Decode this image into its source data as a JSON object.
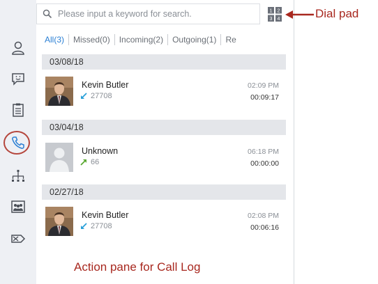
{
  "search": {
    "placeholder": "Please input a keyword for search."
  },
  "dialpad": {
    "icon": "dialpad-icon"
  },
  "tabs": [
    {
      "label": "All(3)",
      "active": true
    },
    {
      "label": "Missed(0)",
      "active": false
    },
    {
      "label": "Incoming(2)",
      "active": false
    },
    {
      "label": "Outgoing(1)",
      "active": false
    },
    {
      "label": "Re",
      "active": false
    }
  ],
  "groups": [
    {
      "date": "03/08/18",
      "entries": [
        {
          "name": "Kevin Butler",
          "number": "27708",
          "direction": "incoming",
          "time": "02:09 PM",
          "duration": "00:09:17",
          "avatar": "photo"
        }
      ]
    },
    {
      "date": "03/04/18",
      "entries": [
        {
          "name": "Unknown",
          "number": "66",
          "direction": "outgoing",
          "time": "06:18 PM",
          "duration": "00:00:00",
          "avatar": "default"
        }
      ]
    },
    {
      "date": "02/27/18",
      "entries": [
        {
          "name": "Kevin Butler",
          "number": "27708",
          "direction": "incoming",
          "time": "02:08 PM",
          "duration": "00:06:16",
          "avatar": "photo"
        }
      ]
    }
  ],
  "sidebar": {
    "items": [
      {
        "icon": "contacts-icon"
      },
      {
        "icon": "chat-icon"
      },
      {
        "icon": "tasks-icon"
      },
      {
        "icon": "call-log-icon",
        "highlighted": true
      },
      {
        "icon": "organization-icon"
      },
      {
        "icon": "group-icon"
      },
      {
        "icon": "voicemail-icon"
      }
    ]
  },
  "annotations": {
    "dial_pad": "Dial pad",
    "action_pane": "Action pane for Call Log"
  },
  "colors": {
    "annotation": "#a8281f",
    "active_tab": "#2a7fd4",
    "incoming_arrow": "#2aa0d8",
    "outgoing_arrow": "#5aa832"
  }
}
